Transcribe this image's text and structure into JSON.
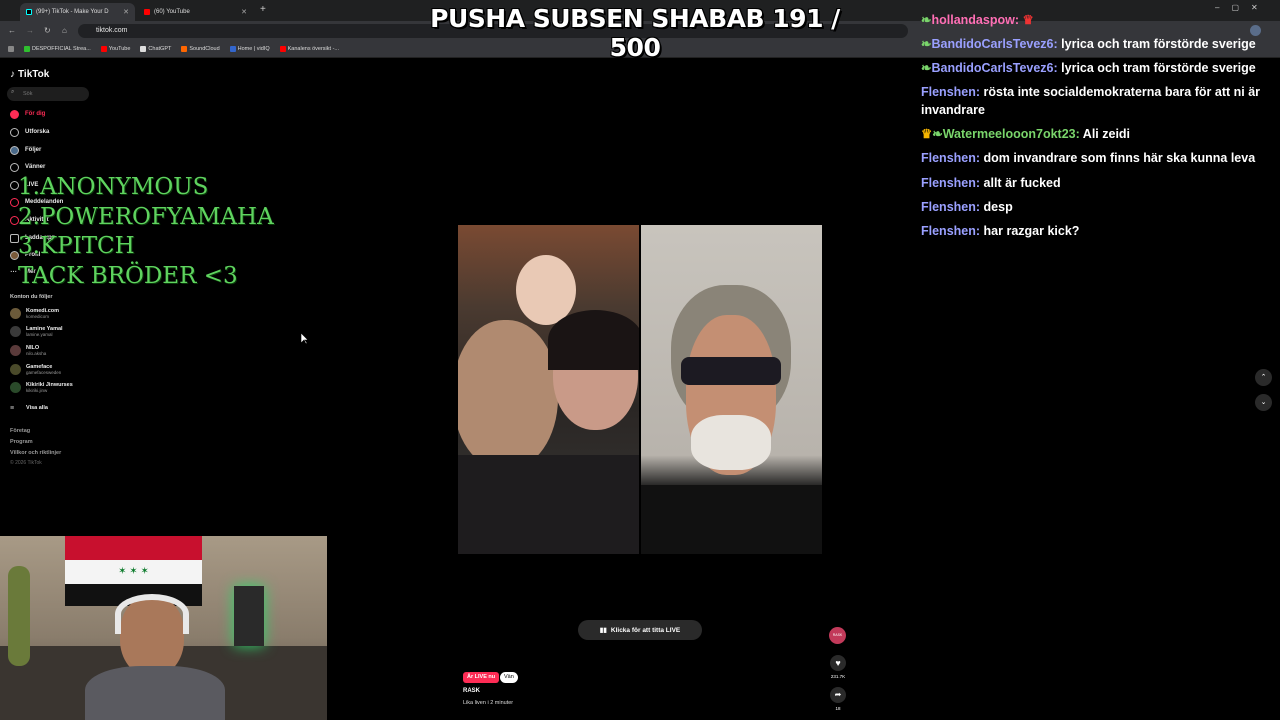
{
  "browser": {
    "tabs": [
      {
        "label": "(99+) TikTok - Make Your D",
        "active": true
      },
      {
        "label": "(60) YouTube",
        "active": false
      }
    ],
    "url": "tiktok.com",
    "bookmarks": [
      "DESPOFFICIAL Strea...",
      "YouTube",
      "ChatGPT",
      "SoundCloud",
      "Home | vidIQ",
      "Kanalens översikt -..."
    ]
  },
  "overlay": {
    "title": "PUSHA SUBSEN SHABAB 191 / 500",
    "donors": [
      "1.ANONYMOUS",
      "2.POWEROFYAMAHA",
      "3.KPITCH",
      "TACK BRÖDER <3"
    ]
  },
  "tiktok": {
    "logo": "TikTok",
    "search_placeholder": "Sök",
    "nav": [
      "För dig",
      "Utforska",
      "Följer",
      "Vänner",
      "LIVE",
      "Meddelanden",
      "Aktivitet",
      "Ladda upp",
      "Profil",
      "Mer"
    ],
    "accounts_header": "Konton du följer",
    "accounts": [
      {
        "name": "Komedi.com",
        "handle": "komedicom"
      },
      {
        "name": "Lamine Yamal",
        "handle": "lamine.yamal"
      },
      {
        "name": "NILO",
        "handle": "nilo.aksha"
      },
      {
        "name": "Gameface",
        "handle": "gamefacesweden"
      },
      {
        "name": "Kikiriki Jinwurses",
        "handle": "kikiriki.jinw"
      }
    ],
    "show_all": "Visa alla",
    "footer": [
      "Företag",
      "Program",
      "Villkor och riktlinjer",
      "© 2026 TikTok"
    ],
    "live_button": "Klicka för att titta LIVE",
    "live_badge": "Är LIVE nu",
    "friend_badge": "Vän",
    "creator": "RASK",
    "caption": "Lika liven i 2 minuter",
    "likes": "231.7K",
    "shares": "18",
    "profile_label": "RASK"
  },
  "chat": [
    {
      "user": "hollandaspow:",
      "msg": ""
    },
    {
      "user": "BandidoCarlsTevez6:",
      "msg": "lyrica och tram förstörde sverige"
    },
    {
      "user": "BandidoCarlsTevez6:",
      "msg": "lyrica och tram förstörde sverige"
    },
    {
      "user": "Flenshen:",
      "msg": "rösta inte socialdemokraterna bara för att ni är invandrare"
    },
    {
      "user": "Watermeelooon7okt23:",
      "msg": "Ali zeidi"
    },
    {
      "user": "Flenshen:",
      "msg": "dom invandrare som finns här ska kunna leva"
    },
    {
      "user": "Flenshen:",
      "msg": "allt är fucked"
    },
    {
      "user": "Flenshen:",
      "msg": "desp"
    },
    {
      "user": "Flenshen:",
      "msg": "har razgar kick?"
    }
  ],
  "colors": {
    "tiktok_red": "#fe2c55",
    "chat_name": "#9aa0ff",
    "donor_green": "#5fd35f"
  }
}
